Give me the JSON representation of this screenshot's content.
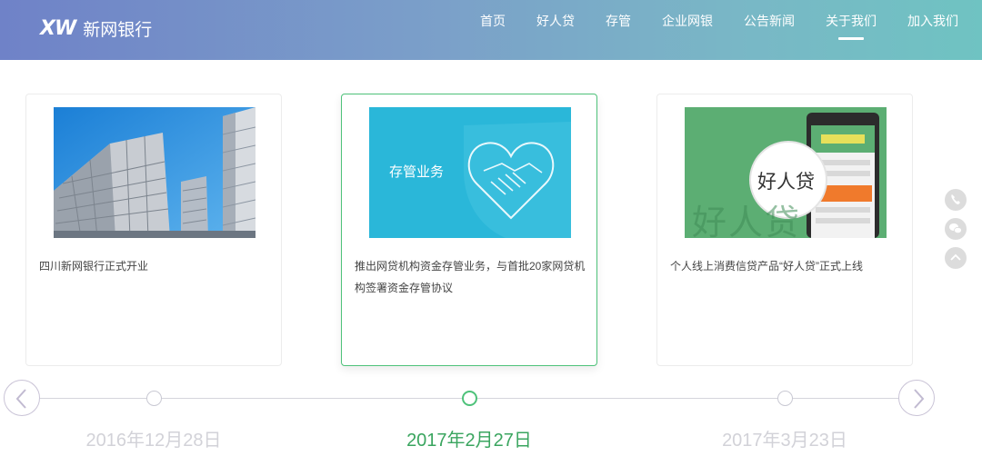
{
  "header": {
    "logo_mark": "XW",
    "logo_text": "新网银行",
    "nav": [
      "首页",
      "好人贷",
      "存管",
      "企业网银",
      "公告新闻",
      "关于我们",
      "加入我们"
    ],
    "active_nav": "关于我们"
  },
  "cards": [
    {
      "image": "skyscraper-photo",
      "text": "四川新网银行正式开业"
    },
    {
      "image": "handshake-heart-illustration",
      "image_caption": "存管业务",
      "text": "推出网贷机构资金存管业务，与首批20家网贷机构签署资金存管协议"
    },
    {
      "image": "haorendai-app-promo",
      "image_badge": "好人贷",
      "image_watermark": "好人贷",
      "text": "个人线上消费信贷产品“好人贷”正式上线"
    }
  ],
  "timeline": {
    "dates": [
      "2016年12月28日",
      "2017年2月27日",
      "2017年3月23日"
    ],
    "active_index": 1,
    "prev_icon": "chevron-left-icon",
    "next_icon": "chevron-right-icon"
  },
  "side_tools": [
    "phone-icon",
    "wechat-icon",
    "back-to-top-icon"
  ],
  "colors": {
    "header_gradient_start": "#6f82c8",
    "header_gradient_end": "#6fc3c2",
    "accent_green": "#4ec27a",
    "date_active": "#3aa55f",
    "date_inactive": "#d2d2d8"
  }
}
